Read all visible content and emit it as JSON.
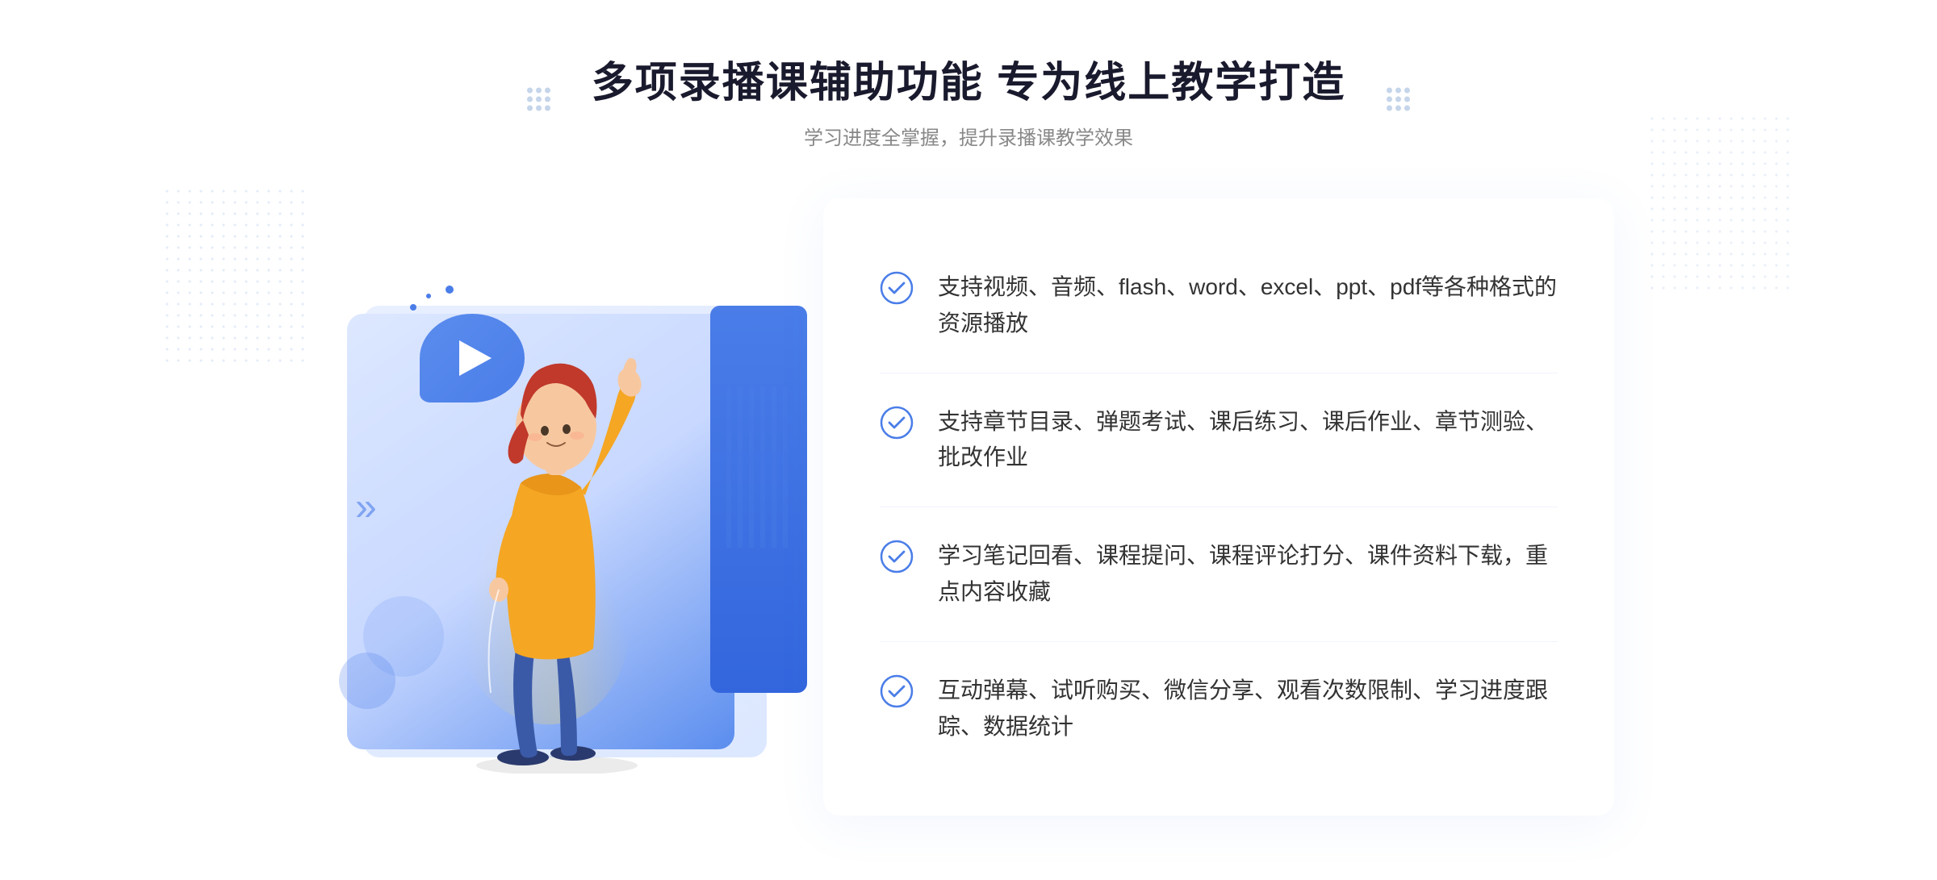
{
  "page": {
    "background": "#ffffff"
  },
  "header": {
    "title": "多项录播课辅助功能 专为线上教学打造",
    "subtitle": "学习进度全掌握，提升录播课教学效果"
  },
  "features": [
    {
      "id": 1,
      "text": "支持视频、音频、flash、word、excel、ppt、pdf等各种格式的资源播放"
    },
    {
      "id": 2,
      "text": "支持章节目录、弹题考试、课后练习、课后作业、章节测验、批改作业"
    },
    {
      "id": 3,
      "text": "学习笔记回看、课程提问、课程评论打分、课件资料下载，重点内容收藏"
    },
    {
      "id": 4,
      "text": "互动弹幕、试听购买、微信分享、观看次数限制、学习进度跟踪、数据统计"
    }
  ],
  "icons": {
    "check": "check-circle-icon",
    "play": "play-icon",
    "chevron": "chevron-icon"
  },
  "colors": {
    "primary": "#4a7de8",
    "title": "#1a1a2e",
    "text": "#333333",
    "subtitle": "#888888",
    "border": "#f0f4ff"
  }
}
